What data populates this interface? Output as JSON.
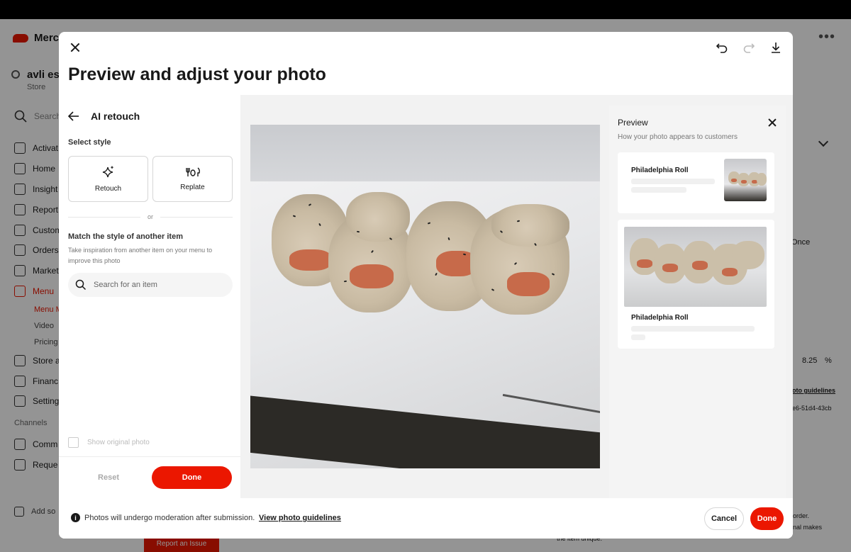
{
  "background_app": {
    "brand": "Merc",
    "store_name": "avli es",
    "store_sub": "Store",
    "search_placeholder": "Search",
    "nav": [
      "Activat",
      "Home",
      "Insight",
      "Report",
      "Custom",
      "Orders",
      "Market",
      "Menu"
    ],
    "menu_sub": [
      "Menu M",
      "Video",
      "Pricing"
    ],
    "nav2": [
      "Store a",
      "Financ",
      "Setting"
    ],
    "channels_label": "Channels",
    "channels": [
      "Comm",
      "Reque"
    ],
    "add_label": "Add so",
    "report_issue": "Report an Issue",
    "right_texts": [
      "Once",
      "8.25",
      "%",
      "oto guidelines",
      "e6-51d4-43cb",
      "order.",
      "nal makes",
      "the item unique."
    ]
  },
  "modal": {
    "title": "Preview and adjust your photo",
    "left_panel": {
      "heading": "AI retouch",
      "select_style_label": "Select style",
      "styles": [
        {
          "label": "Retouch",
          "icon": "sparkle-icon"
        },
        {
          "label": "Replate",
          "icon": "utensils-icon"
        }
      ],
      "or_text": "or",
      "match_title": "Match the style of another item",
      "match_desc": "Take inspiration from another item on your menu to improve this photo",
      "search_placeholder": "Search for an item",
      "show_original_label": "Show original photo",
      "reset_label": "Reset",
      "done_label": "Done"
    },
    "preview": {
      "title": "Preview",
      "subtitle": "How your photo appears to customers",
      "item_name": "Philadelphia Roll"
    },
    "footer": {
      "text": "Photos will undergo moderation after submission.",
      "link": "View photo guidelines",
      "cancel_label": "Cancel",
      "done_label": "Done"
    }
  },
  "colors": {
    "accent": "#eb1700",
    "text": "#191919"
  }
}
